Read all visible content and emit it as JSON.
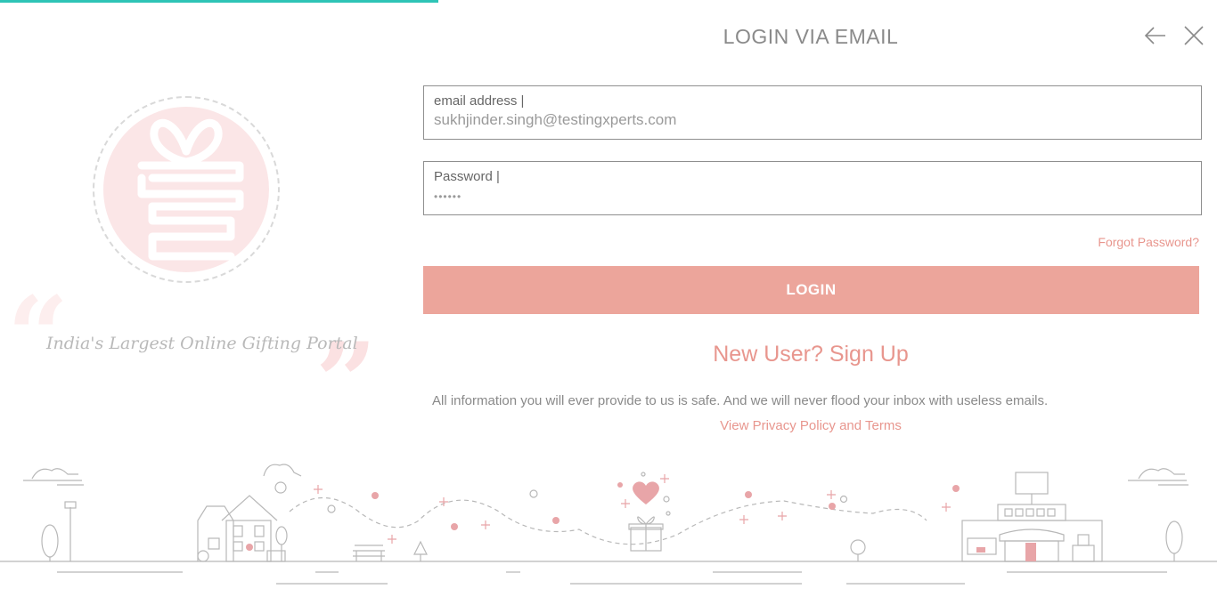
{
  "page": {
    "title": "LOGIN VIA EMAIL",
    "progress_percent": 36
  },
  "brand": {
    "tagline": "India's Largest Online Gifting Portal",
    "quote_open": "“",
    "quote_close": "”"
  },
  "header": {
    "back_icon": "arrow-left-icon",
    "close_icon": "close-icon"
  },
  "form": {
    "email": {
      "label": "email address |",
      "value": "sukhjinder.singh@testingxperts.com"
    },
    "password": {
      "label": "Password |",
      "value": "••••••"
    },
    "forgot_label": "Forgot Password?",
    "login_label": "LOGIN",
    "signup_label": "New User? Sign Up",
    "info_text": "All information you will ever provide to us is safe. And we will never flood your inbox with useless emails.",
    "privacy_label": "View Privacy Policy and Terms"
  },
  "colors": {
    "accent": "#e8968e",
    "button": "#eca59b",
    "progress": "#2ec4b6",
    "logo_bg": "#fbe6e7"
  }
}
